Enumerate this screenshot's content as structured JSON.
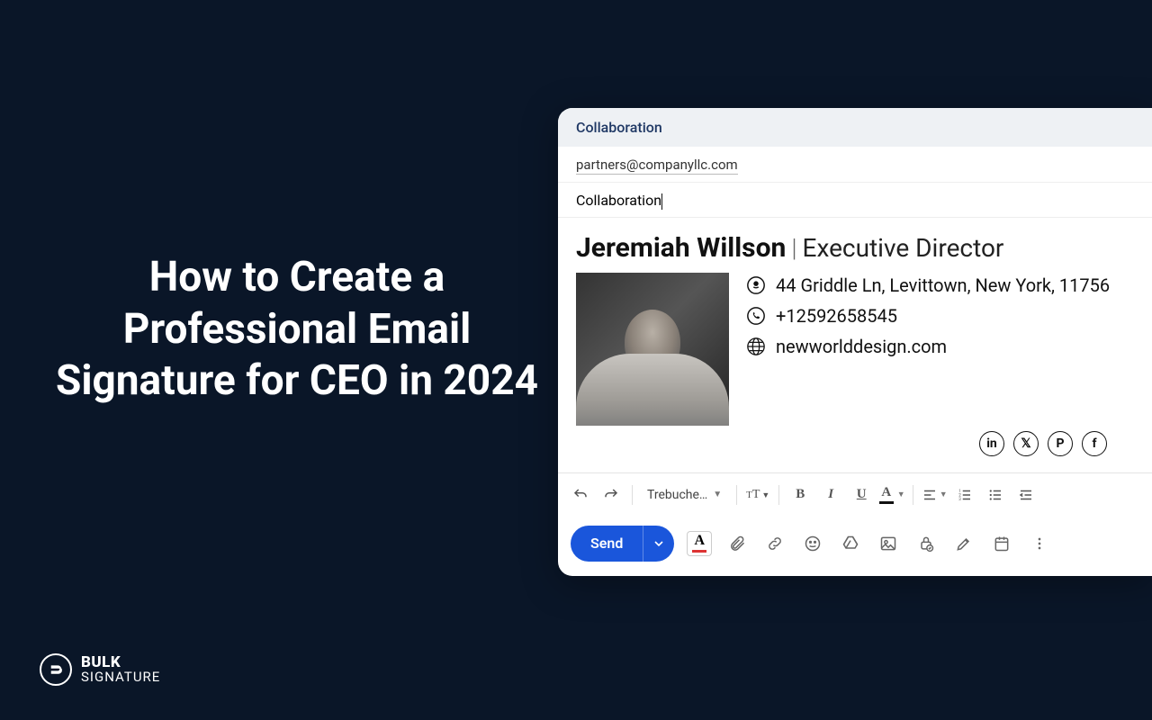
{
  "hero": {
    "title": "How to Create a Professional Email Signature for CEO in 2024"
  },
  "brand": {
    "line1": "BULK",
    "line2": "SIGNATURE"
  },
  "compose": {
    "header_title": "Collaboration",
    "to": "partners@companyllc.com",
    "subject": "Collaboration",
    "font_name": "Trebuche…",
    "send_label": "Send"
  },
  "signature": {
    "name": "Jeremiah Willson",
    "title": "Executive Director",
    "address": "44 Griddle Ln, Levittown, New York, 11756",
    "phone": "+12592658545",
    "website": "newworlddesign.com"
  }
}
